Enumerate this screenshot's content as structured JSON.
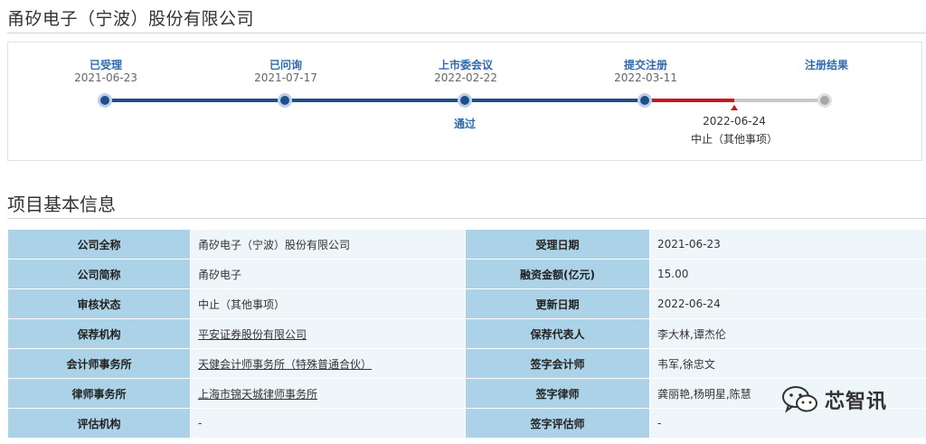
{
  "company_name": "甬矽电子（宁波）股份有限公司",
  "stages": [
    {
      "label": "已受理",
      "date": "2021-06-23"
    },
    {
      "label": "已问询",
      "date": "2021-07-17"
    },
    {
      "label": "上市委会议",
      "date": "2022-02-22",
      "result": "通过"
    },
    {
      "label": "提交注册",
      "date": "2022-03-11"
    },
    {
      "label": "注册结果",
      "date": ""
    }
  ],
  "halt": {
    "date": "2022-06-24",
    "status": "中止（其他事项）"
  },
  "colors": {
    "progress_blue": "#1f4e8c",
    "halt_red": "#c8161d",
    "label_blue": "#2f6ab0",
    "label_bg": "#abd2e6",
    "value_bg": "#eef6fa"
  },
  "section_title": "项目基本信息",
  "rows": [
    {
      "l1": "公司全称",
      "v1": "甬矽电子（宁波）股份有限公司",
      "l2": "受理日期",
      "v2": "2021-06-23"
    },
    {
      "l1": "公司简称",
      "v1": "甬矽电子",
      "l2": "融资金额(亿元)",
      "v2": "15.00"
    },
    {
      "l1": "审核状态",
      "v1": "中止（其他事项）",
      "l2": "更新日期",
      "v2": "2022-06-24"
    },
    {
      "l1": "保荐机构",
      "v1": "平安证券股份有限公司",
      "l2": "保荐代表人",
      "v2": "李大林,谭杰伦"
    },
    {
      "l1": "会计师事务所",
      "v1": "天健会计师事务所（特殊普通合伙）",
      "l2": "签字会计师",
      "v2": "韦军,徐忠文"
    },
    {
      "l1": "律师事务所",
      "v1": "上海市锦天城律师事务所",
      "l2": "签字律师",
      "v2": "龚丽艳,杨明星,陈慧"
    },
    {
      "l1": "评估机构",
      "v1": "-",
      "l2": "签字评估师",
      "v2": "-"
    }
  ],
  "watermark": {
    "text": "芯智讯",
    "icon": "wechat-icon"
  }
}
